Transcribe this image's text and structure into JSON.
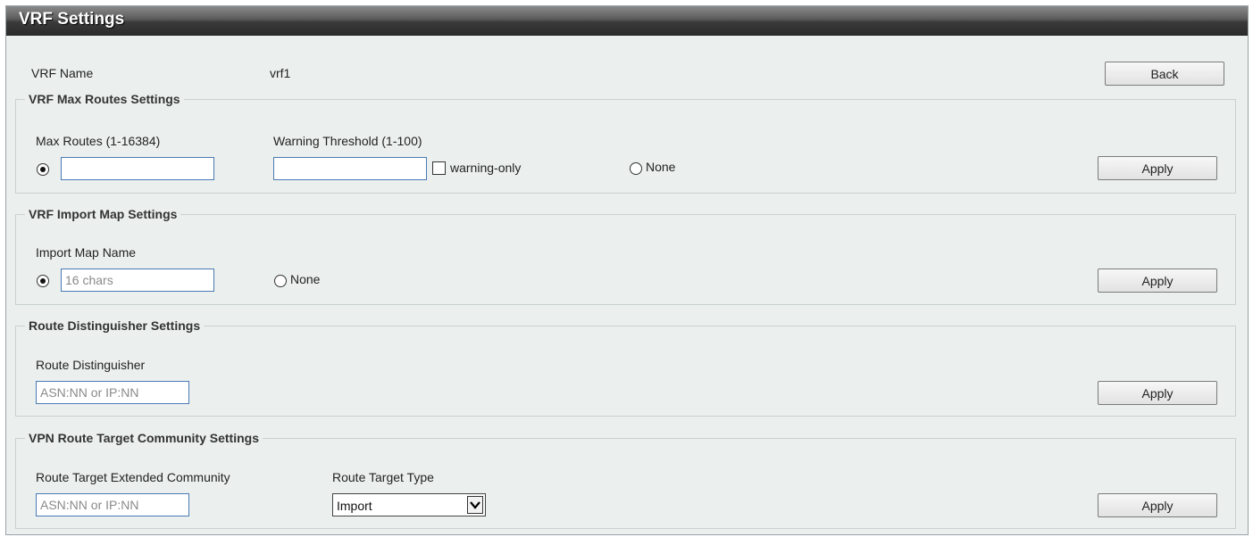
{
  "window": {
    "title": "VRF Settings"
  },
  "vrf": {
    "name_label": "VRF Name",
    "name_value": "vrf1",
    "back_label": "Back"
  },
  "max_routes": {
    "legend": "VRF Max Routes Settings",
    "max_label": "Max Routes (1-16384)",
    "threshold_label": "Warning Threshold (1-100)",
    "max_value": "",
    "threshold_value": "",
    "warning_only_label": "warning-only",
    "warning_only_checked": false,
    "none_label": "None",
    "selected": "max",
    "apply_label": "Apply"
  },
  "import_map": {
    "legend": "VRF Import Map Settings",
    "name_label": "Import Map Name",
    "name_placeholder": "16 chars",
    "none_label": "None",
    "selected": "name",
    "apply_label": "Apply"
  },
  "route_distinguisher": {
    "legend": "Route Distinguisher Settings",
    "label": "Route Distinguisher",
    "placeholder": "ASN:NN or IP:NN",
    "apply_label": "Apply"
  },
  "route_target": {
    "legend": "VPN Route Target Community Settings",
    "community_label": "Route Target Extended Community",
    "community_placeholder": "ASN:NN or IP:NN",
    "type_label": "Route Target Type",
    "type_value": "Import",
    "apply_label": "Apply"
  }
}
